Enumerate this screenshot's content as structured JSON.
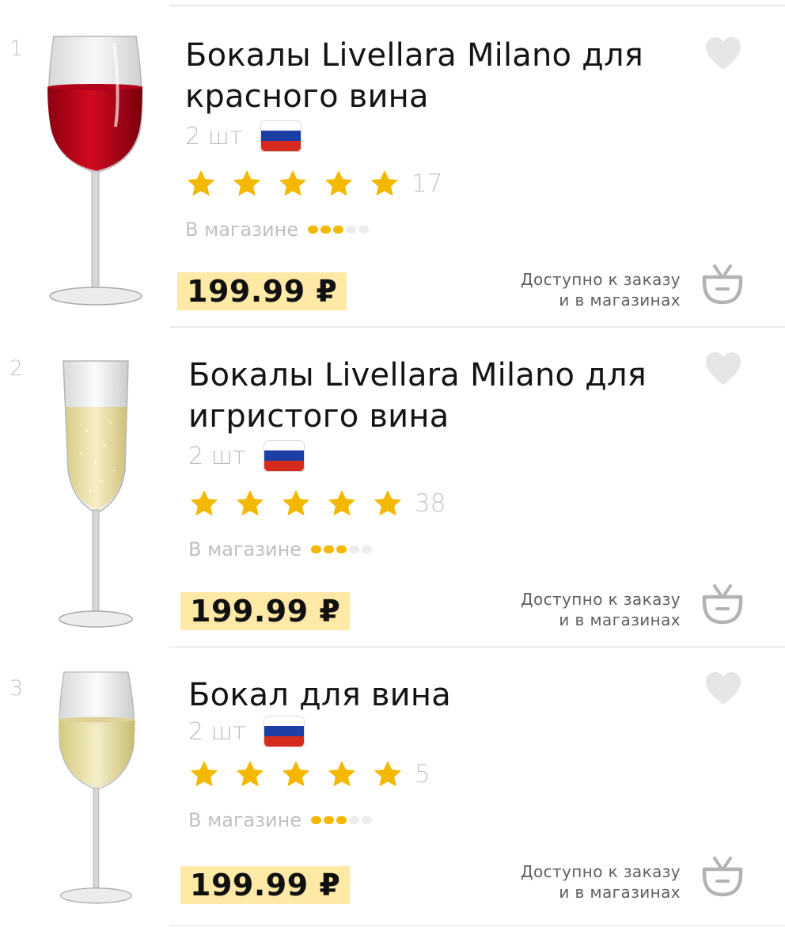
{
  "products": [
    {
      "index": "1",
      "title": "Бокалы Livellara Milano для красного вина",
      "quantity": "2 шт",
      "rating_stars": 5,
      "review_count": "17",
      "stock_label": "В магазине",
      "stock_level": 3,
      "stock_max": 5,
      "price": "199.99 ₽",
      "availability_line1": "Доступно к заказу",
      "availability_line2": "и в магазинах",
      "glass_icon": "red-wine-glass-icon",
      "liquid_color": "#c4081b"
    },
    {
      "index": "2",
      "title": "Бокалы Livellara Milano для игристого вина",
      "quantity": "2 шт",
      "rating_stars": 5,
      "review_count": "38",
      "stock_label": "В магазине",
      "stock_level": 3,
      "stock_max": 5,
      "price": "199.99 ₽",
      "availability_line1": "Доступно к заказу",
      "availability_line2": "и в магазинах",
      "glass_icon": "champagne-flute-icon",
      "liquid_color": "#efe3a6"
    },
    {
      "index": "3",
      "title": "Бокал для вина",
      "quantity": "2 шт",
      "rating_stars": 5,
      "review_count": "5",
      "stock_label": "В магазине",
      "stock_level": 3,
      "stock_max": 5,
      "price": "199.99 ₽",
      "availability_line1": "Доступно к заказу",
      "availability_line2": "и в магазинах",
      "glass_icon": "white-wine-glass-icon",
      "liquid_color": "#e9e0a8"
    }
  ],
  "colors": {
    "star": "#f5b800",
    "price_highlight": "#ffe9a6",
    "heart": "#e6e6e6",
    "cart_icon": "#b3b3b3",
    "muted_text": "#c0c0c0",
    "flag_white": "#ffffff",
    "flag_blue": "#1c3fa6",
    "flag_red": "#d52b1e"
  }
}
